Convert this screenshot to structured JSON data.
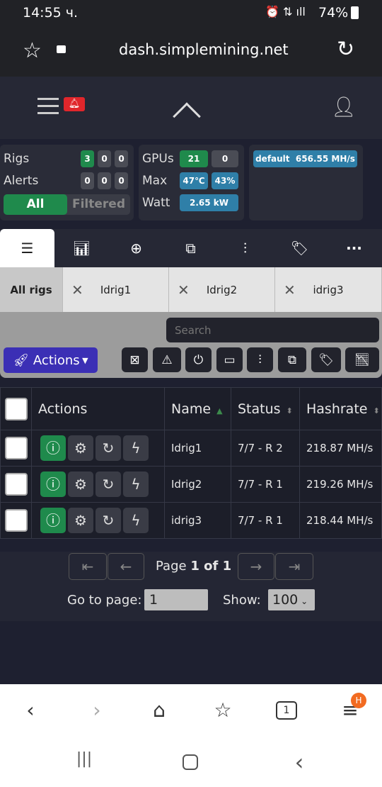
{
  "status_bar": {
    "time": "14:55 ч.",
    "battery": "74%"
  },
  "browser": {
    "url": "dash.simplemining.net"
  },
  "header": {
    "alert_icon": "bell-icon"
  },
  "stats": {
    "rigs_label": "Rigs",
    "rigs": [
      "3",
      "0",
      "0"
    ],
    "alerts_label": "Alerts",
    "alerts": [
      "0",
      "0",
      "0"
    ],
    "filter_all": "All",
    "filter_filtered": "Filtered",
    "gpus_label": "GPUs",
    "gpus": [
      "21",
      "0"
    ],
    "max_label": "Max",
    "max_temp": "47℃",
    "max_fan": "43%",
    "watt_label": "Watt",
    "watt": "2.65 kW",
    "group_name": "default",
    "group_hashrate": "656.55 MH/s"
  },
  "colors": {
    "green": "#1f8a4c",
    "blue": "#2f7fa8",
    "actions": "#3b2fb5"
  },
  "rig_tabs": [
    "All rigs",
    "Idrig1",
    "Idrig2",
    "idrig3"
  ],
  "search": {
    "placeholder": "Search"
  },
  "actions_label": "Actions",
  "table": {
    "headers": [
      "Actions",
      "Name",
      "Status",
      "Hashrate"
    ],
    "rows": [
      {
        "name": "Idrig1",
        "status": "7/7 - R 2",
        "hashrate": "218.87 MH/s"
      },
      {
        "name": "Idrig2",
        "status": "7/7 - R 1",
        "hashrate": "219.26 MH/s"
      },
      {
        "name": "idrig3",
        "status": "7/7 - R 1",
        "hashrate": "218.44 MH/s"
      }
    ]
  },
  "pager": {
    "page_prefix": "Page ",
    "page_value": "1 of 1",
    "goto_label": "Go to page:",
    "goto_value": "1",
    "show_label": "Show:",
    "show_value": "100"
  },
  "bottom_nav": {
    "tabs_count": "1",
    "badge": "H"
  }
}
